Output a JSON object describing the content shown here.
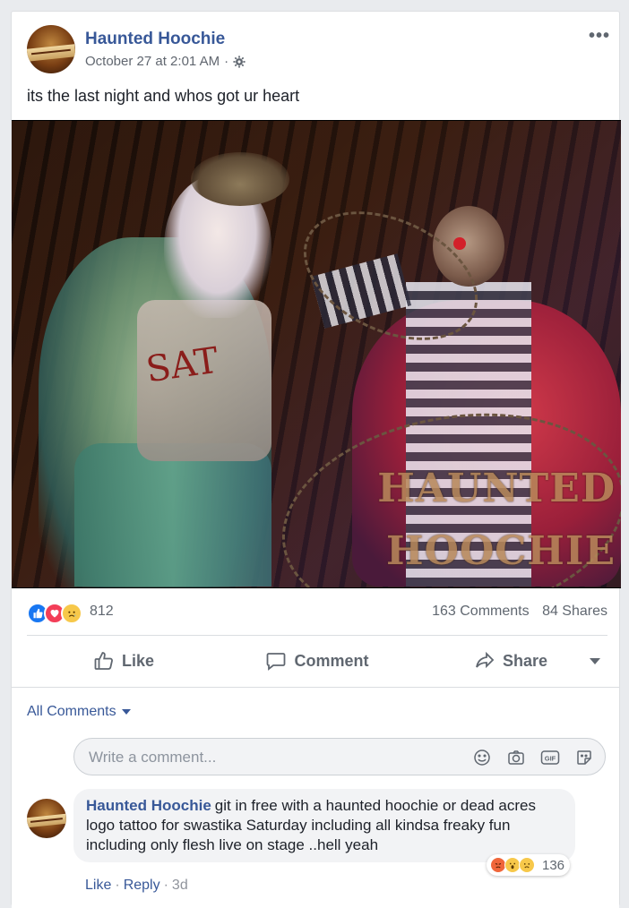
{
  "post": {
    "author": "Haunted Hoochie",
    "timestamp": "October 27 at 2:01 AM",
    "separator": "·",
    "privacy_icon": "gear-icon",
    "more_label": "•••",
    "text": "its the last night and whos got ur heart",
    "photo": {
      "shirt_text": "SAT",
      "watermark_line1": "HAUNTED",
      "watermark_line2": "HOOCHIE"
    }
  },
  "stats": {
    "reactions": [
      "like",
      "love",
      "sad"
    ],
    "reaction_count": "812",
    "comments": "163 Comments",
    "shares": "84 Shares"
  },
  "actions": {
    "like": "Like",
    "comment": "Comment",
    "share": "Share"
  },
  "comments_section": {
    "filter_label": "All Comments",
    "write_placeholder": "Write a comment...",
    "tools": [
      "emoji-icon",
      "camera-icon",
      "gif-icon",
      "sticker-icon"
    ],
    "gif_label": "GIF",
    "comment": {
      "author": "Haunted Hoochie",
      "text": "git in free with a haunted hoochie or dead acres logo tattoo for swastika Saturday including all kindsa freaky fun including only flesh live on stage ..hell yeah",
      "reactions": [
        "angry",
        "wow",
        "sad"
      ],
      "reaction_count": "136",
      "like_label": "Like",
      "reply_label": "Reply",
      "time": "3d",
      "separator": "·"
    }
  },
  "colors": {
    "link_blue": "#385898",
    "like_blue": "#1877f2",
    "love_red": "#f33e58",
    "meta_gray": "#606770"
  }
}
